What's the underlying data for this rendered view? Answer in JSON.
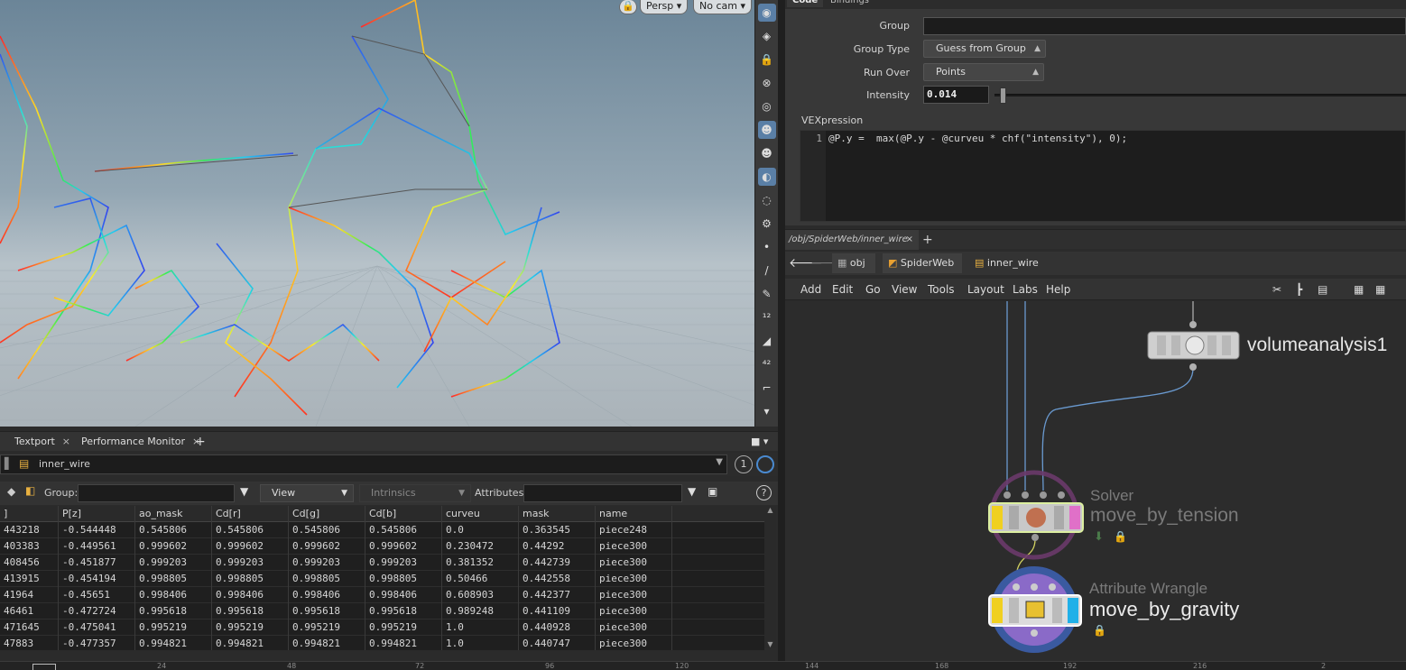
{
  "viewport": {
    "projection_button": "Persp ▾",
    "camera_button": "No cam ▾",
    "lock_icon": "lock-icon"
  },
  "bottom_left": {
    "tabs": [
      {
        "label": "Textport"
      },
      {
        "label": "Performance Monitor"
      }
    ],
    "tab_close": "×",
    "add_tab": "+",
    "node_path": "inner_wire",
    "counter": "1",
    "group_label": "Group:",
    "view_label": "View",
    "intrinsics_label": "Intrinsics",
    "attributes_label": "Attributes:",
    "help": "?",
    "table": {
      "columns": [
        "]",
        "P[z]",
        "ao_mask",
        "Cd[r]",
        "Cd[g]",
        "Cd[b]",
        "curveu",
        "mask",
        "name"
      ],
      "rows": [
        [
          "443218",
          "-0.544448",
          "0.545806",
          "0.545806",
          "0.545806",
          "0.545806",
          "0.0",
          "0.363545",
          "piece248"
        ],
        [
          "403383",
          "-0.449561",
          "0.999602",
          "0.999602",
          "0.999602",
          "0.999602",
          "0.230472",
          "0.44292",
          "piece300"
        ],
        [
          "408456",
          "-0.451877",
          "0.999203",
          "0.999203",
          "0.999203",
          "0.999203",
          "0.381352",
          "0.442739",
          "piece300"
        ],
        [
          "413915",
          "-0.454194",
          "0.998805",
          "0.998805",
          "0.998805",
          "0.998805",
          "0.50466",
          "0.442558",
          "piece300"
        ],
        [
          "41964",
          "-0.45651",
          "0.998406",
          "0.998406",
          "0.998406",
          "0.998406",
          "0.608903",
          "0.442377",
          "piece300"
        ],
        [
          "46461",
          "-0.472724",
          "0.995618",
          "0.995618",
          "0.995618",
          "0.995618",
          "0.989248",
          "0.441109",
          "piece300"
        ],
        [
          "471645",
          "-0.475041",
          "0.995219",
          "0.995219",
          "0.995219",
          "0.995219",
          "1.0",
          "0.440928",
          "piece300"
        ],
        [
          "47883",
          "-0.477357",
          "0.994821",
          "0.994821",
          "0.994821",
          "0.994821",
          "1.0",
          "0.440747",
          "piece300"
        ]
      ]
    }
  },
  "timeline": {
    "ticks": [
      "24",
      "48",
      "72",
      "96",
      "120",
      "144",
      "168",
      "192",
      "216",
      "2"
    ]
  },
  "params": {
    "tabs": [
      "Code",
      "Bindings"
    ],
    "group_label": "Group",
    "group_value": "",
    "group_type_label": "Group Type",
    "group_type_value": "Guess from Group",
    "run_over_label": "Run Over",
    "run_over_value": "Points",
    "intensity_label": "Intensity",
    "intensity_value": "0.014",
    "intensity_fraction": 0.014,
    "vex_label": "VEXpression",
    "vex_line_number": "1",
    "vex_code": "@P.y =  max(@P.y - @curveu * chf(\"intensity\"), 0);"
  },
  "network": {
    "tab_path": "/obj/SpiderWeb/inner_wire",
    "tab_close": "×",
    "add_tab": "+",
    "breadcrumbs": [
      "obj",
      "SpiderWeb",
      "inner_wire"
    ],
    "menu": [
      "Add",
      "Edit",
      "Go",
      "View",
      "Tools",
      "Layout",
      "Labs",
      "Help"
    ],
    "nodes": {
      "volume": {
        "name": "volumeanalysis1"
      },
      "solver": {
        "type": "Solver",
        "name": "move_by_tension"
      },
      "wrangle": {
        "type": "Attribute Wrangle",
        "name": "move_by_gravity"
      }
    }
  },
  "colors": {
    "accent_blue": "#5a7fa6",
    "node_yellow": "#f0d020",
    "node_pink": "#e070c8",
    "node_cyan": "#20b0e8",
    "wire_blue": "#6a9ad0"
  }
}
